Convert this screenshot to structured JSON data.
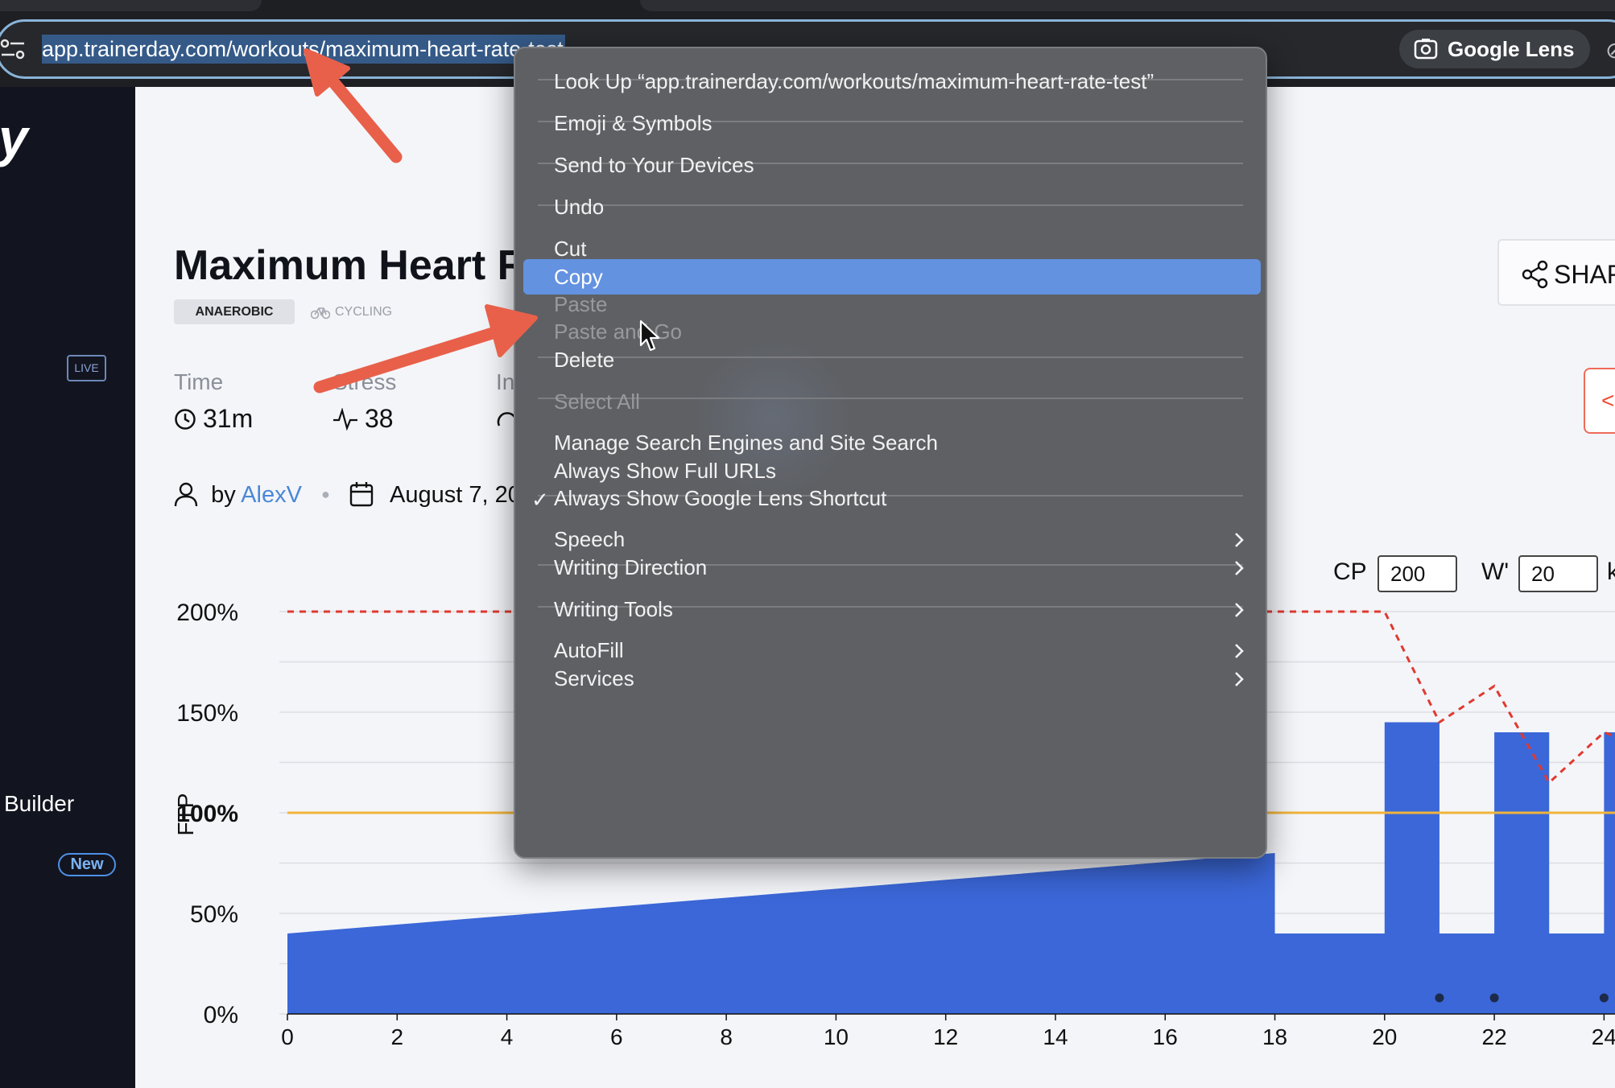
{
  "browser": {
    "url": "app.trainerday.com/workouts/maximum-heart-rate-test",
    "lens_label": "Google Lens"
  },
  "sidebar": {
    "logo_fragment": "y",
    "live_badge": "LIVE",
    "builder_label": "Builder",
    "new_badge": "New"
  },
  "workout": {
    "title": "Maximum Heart Rate Test",
    "tags": [
      "ANAEROBIC",
      "CYCLING"
    ],
    "stats": {
      "time_label": "Time",
      "time_value": "31m",
      "stress_label": "Stress",
      "stress_value": "38",
      "intensity_label": "In"
    },
    "author_prefix": "by",
    "author": "AlexV",
    "date": "August 7, 20",
    "share_label": "SHAR"
  },
  "power_inputs": {
    "cp_label": "CP",
    "cp_value": "200",
    "w_label": "W'",
    "w_value": "20",
    "unit_fragment": "k"
  },
  "context_menu": {
    "items": [
      {
        "label": "Look Up “app.trainerday.com/workouts/maximum-heart-rate-test”"
      },
      {
        "label": "Emoji & Symbols"
      },
      {
        "label": "Send to Your Devices"
      },
      {
        "label": "Undo"
      },
      {
        "label": "Cut"
      },
      {
        "label": "Copy",
        "highlighted": true
      },
      {
        "label": "Paste",
        "disabled": true
      },
      {
        "label": "Paste and Go",
        "disabled": true
      },
      {
        "label": "Delete"
      },
      {
        "label": "Select All",
        "disabled": true
      },
      {
        "label": "Manage Search Engines and Site Search"
      },
      {
        "label": "Always Show Full URLs"
      },
      {
        "label": "Always Show Google Lens Shortcut",
        "checked": true
      },
      {
        "label": "Speech",
        "submenu": true
      },
      {
        "label": "Writing Direction",
        "submenu": true
      },
      {
        "label": "Writing Tools",
        "submenu": true
      },
      {
        "label": "AutoFill",
        "submenu": true
      },
      {
        "label": "Services",
        "submenu": true
      }
    ]
  },
  "chart_data": {
    "type": "area",
    "ylabel": "FTP",
    "y_ticks": [
      "0%",
      "50%",
      "100%",
      "150%",
      "200%"
    ],
    "x_ticks": [
      "0",
      "2",
      "4",
      "6",
      "8",
      "10",
      "12",
      "14",
      "16",
      "18",
      "20",
      "22",
      "24"
    ],
    "xlim": [
      0,
      24.2
    ],
    "ylim": [
      0,
      200
    ],
    "ftp_line_pct": 100,
    "power_profile": {
      "x": [
        0,
        18,
        18,
        20,
        20,
        21,
        21,
        22,
        22,
        23,
        23,
        24,
        24,
        24.2
      ],
      "y": [
        40,
        80,
        40,
        40,
        145,
        145,
        40,
        40,
        140,
        140,
        40,
        40,
        140,
        140
      ]
    },
    "wprime_line": {
      "x": [
        0,
        4,
        19,
        20,
        21,
        22,
        23,
        24,
        24.2
      ],
      "y": [
        200,
        200,
        200,
        200,
        145,
        163,
        115,
        140,
        138
      ]
    },
    "interval_markers_x": [
      21,
      22,
      24
    ],
    "colors": {
      "power": "#3b67d8",
      "ftp_line": "#f0b43c",
      "wprime_line": "#e03a2f",
      "highlight": "#6392e0",
      "arrow": "#e8604a"
    }
  }
}
